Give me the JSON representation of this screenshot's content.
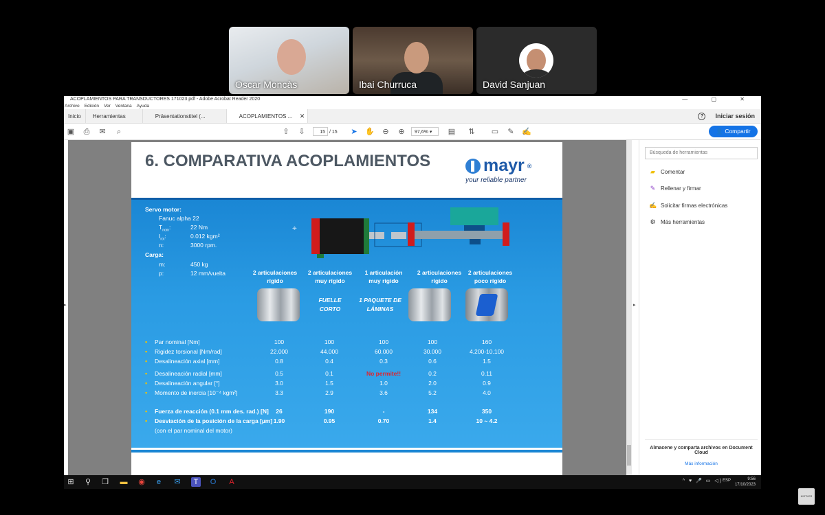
{
  "participants": [
    {
      "name": "Oscar Moncàs"
    },
    {
      "name": "Ibai Churruca"
    },
    {
      "name": "David Sanjuan"
    }
  ],
  "window": {
    "title": "ACOPLAMIENTOS PARA TRANSDUCTORES 171023.pdf - Adobe Acrobat Reader 2020",
    "controls": "—  ▢  ✕",
    "menu": [
      "Archivo",
      "Edición",
      "Ver",
      "Ventana",
      "Ayuda"
    ]
  },
  "tabs": [
    {
      "label": "Inicio"
    },
    {
      "label": "Herramientas"
    },
    {
      "label": "Präsentationstitel (..."
    },
    {
      "label": "ACOPLAMIENTOS ...",
      "close": "✕"
    }
  ],
  "header": {
    "help": "?",
    "signin": "Iniciar sesión"
  },
  "toolbar": {
    "page_current": "15",
    "page_total": "/ 15",
    "zoom": "97,6%",
    "zoom_caret": "▾",
    "share": "Compartir"
  },
  "tools_panel": {
    "search_placeholder": "Búsqueda de herramientas",
    "items": [
      {
        "label": "Comentar",
        "icon": "comment-icon",
        "color": "#f0c000"
      },
      {
        "label": "Rellenar y firmar",
        "icon": "fill-sign-icon",
        "color": "#8b3cc6"
      },
      {
        "label": "Solicitar firmas electrónicas",
        "icon": "request-signature-icon",
        "color": "#8b3cc6"
      },
      {
        "label": "Más herramientas",
        "icon": "more-tools-icon",
        "color": "#333333"
      }
    ],
    "cloud_text": "Almacene y comparta archivos en Document Cloud",
    "cloud_link": "Más información"
  },
  "slide": {
    "title": "6. COMPARATIVA ACOPLAMIENTOS",
    "logo": {
      "brand": "mayr",
      "reg": "®",
      "tagline": "your reliable partner"
    },
    "servo_label": "Servo motor:",
    "servo_model": "Fanuc alpha 22",
    "servo_params": [
      {
        "sym": "T",
        "sub": "nom",
        "value": "22 Nm"
      },
      {
        "sym": "I",
        "sub": "rot",
        "value": "0.012 kgm²"
      },
      {
        "sym": "n:",
        "sub": "",
        "value": "3000 rpm."
      }
    ],
    "carga_label": "Carga:",
    "carga_params": [
      {
        "sym": "m:",
        "value": "450 kg"
      },
      {
        "sym": "p:",
        "value": "12 mm/vuelta"
      }
    ],
    "columns": [
      {
        "line1": "2 articulaciones",
        "line2": "rígido"
      },
      {
        "line1": "2 articulaciones",
        "line2": "muy rígido"
      },
      {
        "line1": "1 articulación",
        "line2": "muy rígido"
      },
      {
        "line1": "2 articulaciones",
        "line2": "rígido"
      },
      {
        "line1": "2 articulaciones",
        "line2": "poco rígido"
      }
    ],
    "fuelle": {
      "line1": "FUELLE",
      "line2": "CORTO"
    },
    "paquete": {
      "line1": "1 PAQUETE DE",
      "line2": "LÁMINAS"
    },
    "rows": [
      {
        "label": "Par nominal [Nm]",
        "values": [
          "100",
          "100",
          "100",
          "100",
          "160"
        ]
      },
      {
        "label": "Rigidez torsional [Nm/rad]",
        "values": [
          "22.000",
          "44.000",
          "60.000",
          "30.000",
          "4.200-10.100"
        ]
      },
      {
        "label": "Desalineación axial [mm]",
        "values": [
          "0.8",
          "0.4",
          "0.3",
          "0.6",
          "1.5"
        ]
      },
      {
        "label": "Desalineación radial [mm]",
        "values": [
          "0.5",
          "0.1",
          "No permite!!",
          "0.2",
          "0.11"
        ]
      },
      {
        "label": "Desalineación angular [°]",
        "values": [
          "3.0",
          "1.5",
          "1.0",
          "2.0",
          "0.9"
        ]
      },
      {
        "label": "Momento de inercia [10⁻⁴ kgm²]",
        "values": [
          "3.3",
          "2.9",
          "3.6",
          "5.2",
          "4.0"
        ]
      }
    ],
    "bold_rows": [
      {
        "label": "Fuerza de reacción (0.1 mm des. rad.) [N]",
        "values": [
          "26",
          "190",
          "-",
          "134",
          "350"
        ]
      },
      {
        "label": "Desviación de la posición de la carga [µm]",
        "values": [
          "1.90",
          "0.95",
          "0.70",
          "1.4",
          "10 ~ 4.2"
        ]
      }
    ],
    "footnote": "(con el par nominal del motor)"
  },
  "taskbar": {
    "time": "9:56",
    "date": "17/10/2023",
    "lang": "ESP",
    "icons": [
      "windows-icon",
      "search-icon",
      "task-view-icon",
      "file-explorer-icon",
      "chrome-icon",
      "edge-icon",
      "mail-icon",
      "teams-icon",
      "outlook-icon",
      "acrobat-icon"
    ]
  },
  "corner_logo": "KISTLER"
}
